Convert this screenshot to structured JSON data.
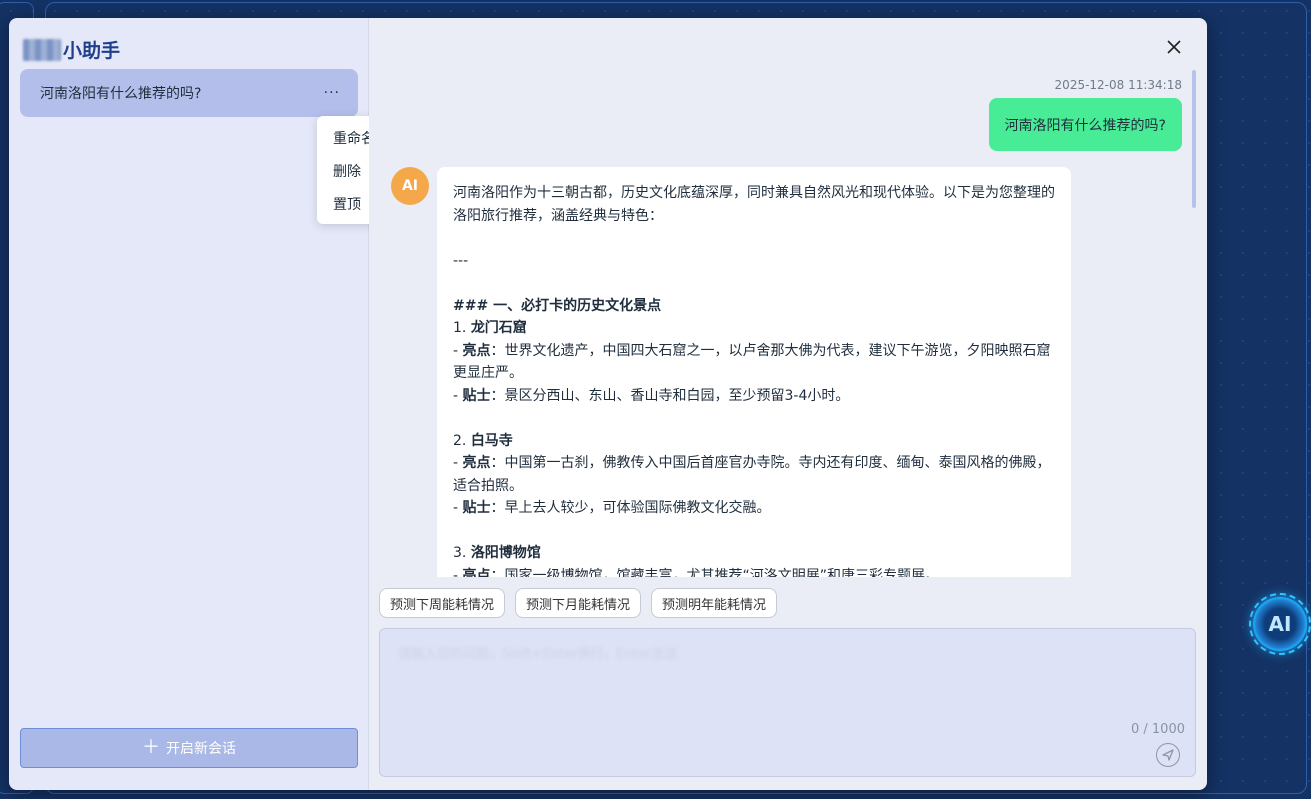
{
  "app": {
    "title": "小助手",
    "floating_button_label": "AI"
  },
  "sidebar": {
    "sessions": [
      {
        "title": "河南洛阳有什么推荐的吗?",
        "more_label": "···"
      }
    ],
    "context_menu": [
      "重命名",
      "删除",
      "置顶"
    ],
    "new_chat_label": "开启新会话"
  },
  "chat": {
    "close_icon": "close-icon",
    "messages": {
      "user": {
        "timestamp": "2025-12-08 11:34:18",
        "text": "河南洛阳有什么推荐的吗?"
      },
      "ai": {
        "avatar": "AI",
        "intro": "河南洛阳作为十三朝古都，历史文化底蕴深厚，同时兼具自然风光和现代体验。以下是为您整理的洛阳旅行推荐，涵盖经典与特色：",
        "separator": "---",
        "section_heading": "### 一、必打卡的历史文化景点",
        "items": [
          {
            "num": "1.",
            "name": "龙门石窟",
            "highlight_label": "亮点",
            "highlight": "：世界文化遗产，中国四大石窟之一，以卢舍那大佛为代表，建议下午游览，夕阳映照石窟更显庄严。",
            "tip_label": "贴士",
            "tip": "：景区分西山、东山、香山寺和白园，至少预留3-4小时。"
          },
          {
            "num": "2.",
            "name": "白马寺",
            "highlight_label": "亮点",
            "highlight": "：中国第一古刹，佛教传入中国后首座官办寺院。寺内还有印度、缅甸、泰国风格的佛殿，适合拍照。",
            "tip_label": "贴士",
            "tip": "：早上去人较少，可体验国际佛教文化交融。"
          },
          {
            "num": "3.",
            "name": "洛阳博物馆",
            "highlight_label": "亮点",
            "highlight": "：国家一级博物馆，馆藏丰富，尤其推荐“河洛文明展”和唐三彩专题展。"
          }
        ]
      }
    },
    "suggestions": [
      "预测下周能耗情况",
      "预测下月能耗情况",
      "预测明年能耗情况"
    ],
    "input": {
      "value": "",
      "placeholder": "请输入您的问题，Shift+Enter换行，Enter发送",
      "counter": "0 / 1000"
    },
    "send_icon": "send-icon"
  },
  "colors": {
    "user_bubble": "#48ec96",
    "ai_avatar": "#f5a84a",
    "sidebar_bg": "#e4e8f8",
    "session_active": "#b3bfea",
    "brand": "#1f3f8a"
  }
}
